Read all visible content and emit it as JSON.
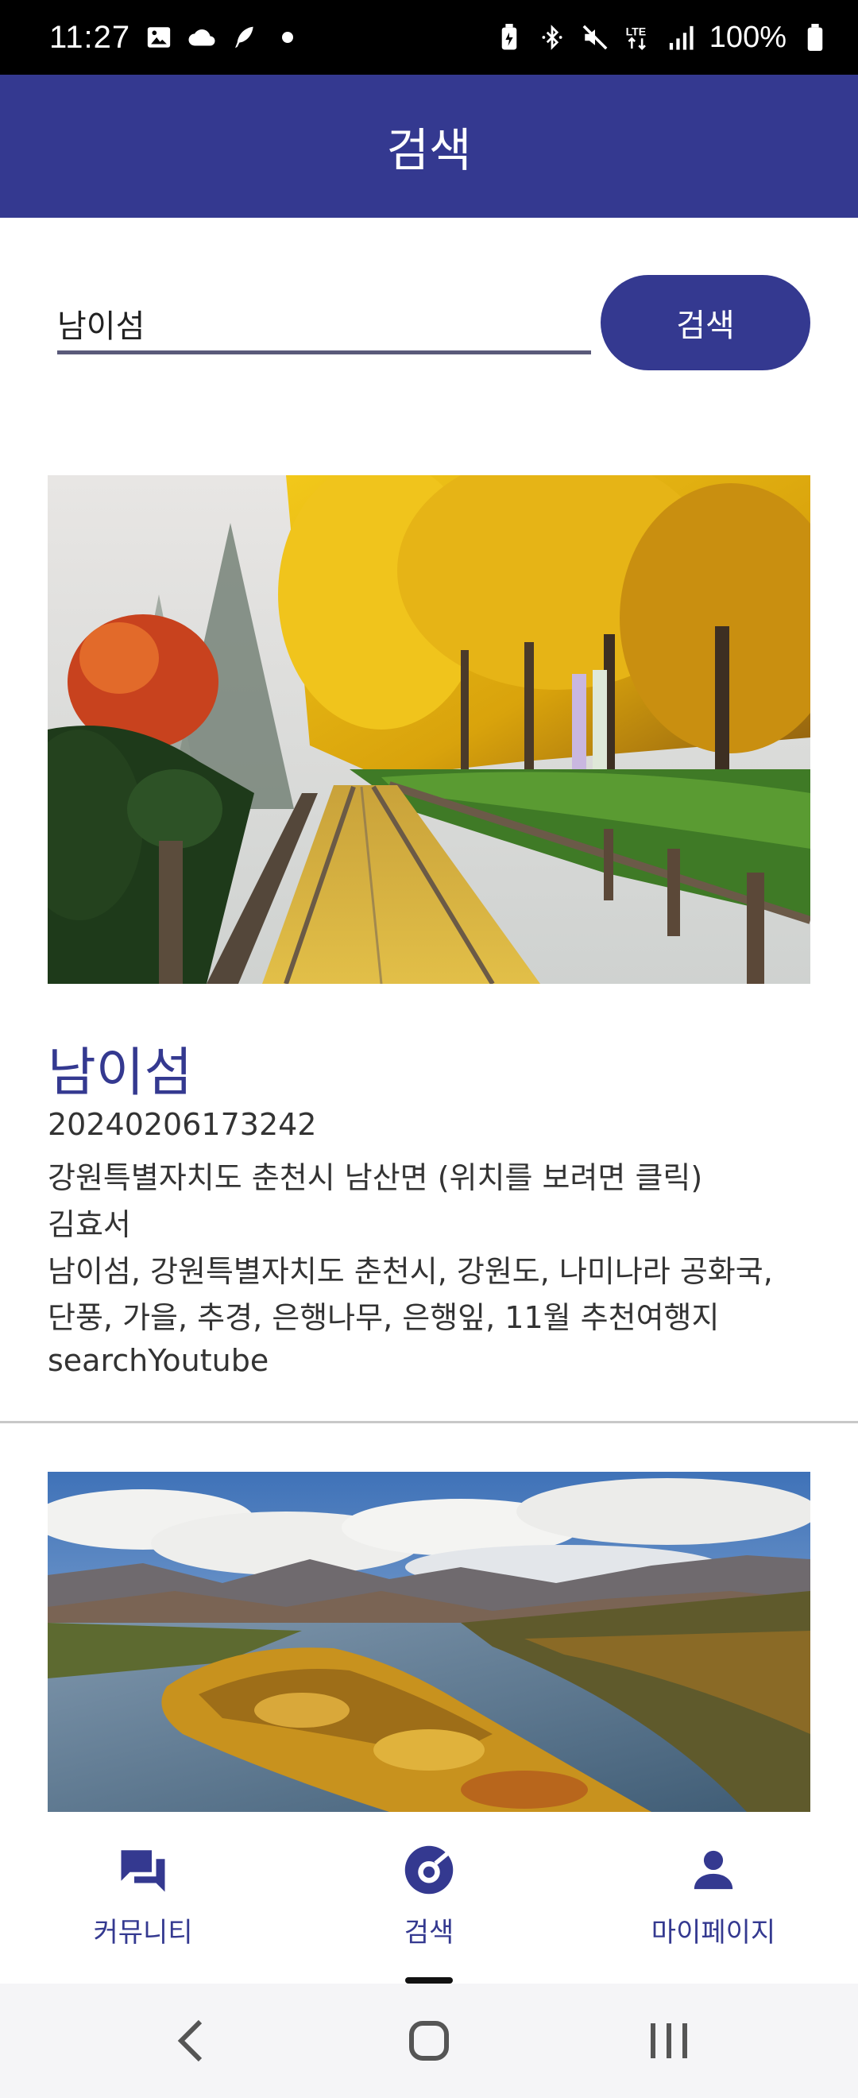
{
  "status_bar": {
    "time": "11:27",
    "battery": "100%",
    "left_icons": [
      "gallery-icon",
      "cloud-icon",
      "feather-icon",
      "dot-icon"
    ],
    "right_icons": [
      "battery-saver-icon",
      "bluetooth-icon",
      "mute-icon",
      "lte-icon",
      "signal-icon",
      "battery-icon"
    ]
  },
  "app_bar": {
    "title": "검색"
  },
  "search": {
    "value": "남이섬",
    "button_label": "검색"
  },
  "results": [
    {
      "title": "남이섬",
      "id": "20240206173242",
      "location": "강원특별자치도 춘천시 남산면 (위치를 보려면 클릭)",
      "author": "김효서",
      "tags_line1": "남이섬, 강원특별자치도 춘천시, 강원도, 나미나라 공화국,",
      "tags_line2": "단풍, 가을, 추경, 은행나무, 은행잎, 11월 추천여행지",
      "youtube": "searchYoutube",
      "image": "autumn ginkgo tree railway path"
    },
    {
      "image": "aerial view of island in river with autumn foliage"
    }
  ],
  "bottom_nav": {
    "items": [
      {
        "label": "커뮤니티",
        "icon": "forum-icon"
      },
      {
        "label": "검색",
        "icon": "explore-search-icon"
      },
      {
        "label": "마이페이지",
        "icon": "person-icon"
      }
    ]
  },
  "colors": {
    "primary": "#343990",
    "status_bar": "#000000",
    "system_nav": "#f5f5f7"
  }
}
